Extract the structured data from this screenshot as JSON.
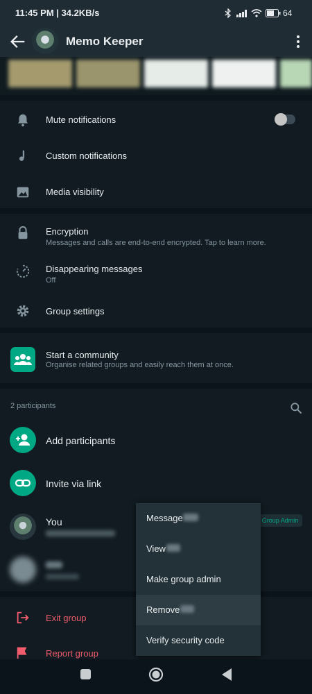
{
  "status_bar": {
    "time": "11:45 PM | 34.2KB/s",
    "battery": "64",
    "icons": [
      "bluetooth-icon",
      "signal-icon",
      "wifi-icon",
      "battery-icon"
    ]
  },
  "header": {
    "title": "Memo Keeper",
    "back_icon": "arrow-back-icon",
    "menu_icon": "more-vert-icon"
  },
  "notifications": {
    "mute_label": "Mute notifications",
    "mute_on": false,
    "custom_label": "Custom notifications",
    "media_label": "Media visibility"
  },
  "security": {
    "encryption_title": "Encryption",
    "encryption_sub": "Messages and calls are end-to-end encrypted. Tap to learn more.",
    "disappearing_title": "Disappearing messages",
    "disappearing_sub": "Off",
    "group_settings": "Group settings"
  },
  "community": {
    "title": "Start a community",
    "subtitle": "Organise related groups and easily reach them at once."
  },
  "participants": {
    "count_label": "2 participants",
    "add_label": "Add participants",
    "invite_label": "Invite via link",
    "you_name": "You",
    "admin_badge": "Group Admin"
  },
  "actions": {
    "exit_label": "Exit group",
    "report_label": "Report group"
  },
  "context_menu": {
    "items": [
      "Message",
      "View",
      "Make group admin",
      "Remove",
      "Verify security code"
    ]
  },
  "colors": {
    "accent": "#00a884",
    "danger": "#f15c6d",
    "background": "#0b141a",
    "surface": "#111b21"
  }
}
